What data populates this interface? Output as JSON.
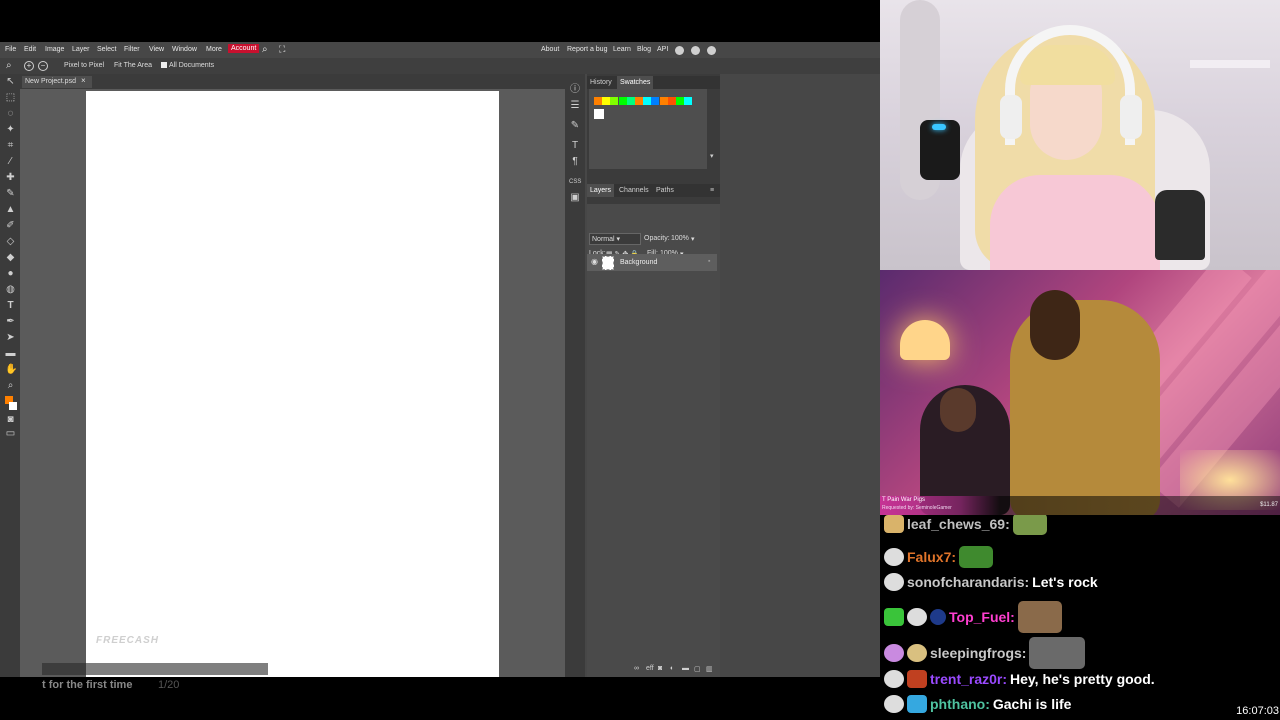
{
  "editor": {
    "menu": [
      "File",
      "Edit",
      "Image",
      "Layer",
      "Select",
      "Filter",
      "View",
      "Window",
      "More"
    ],
    "account_label": "Account",
    "right_links": [
      "About",
      "Report a bug",
      "Learn",
      "Blog",
      "API"
    ],
    "options": {
      "pixel_to_pixel": "Pixel to Pixel",
      "fit_area": "Fit The Area",
      "all_documents": "All Documents"
    },
    "document_tab": "New Project.psd",
    "watermark": "FREECASH",
    "panel_tabs_top": [
      "History",
      "Swatches"
    ],
    "active_top_tab": "Swatches",
    "swatches": [
      "#ff8000",
      "#ffff00",
      "#80ff00",
      "#00ff00",
      "#00ff80",
      "#ff8000",
      "#00ffff",
      "#0080ff",
      "#ff8000",
      "#ff5000",
      "#00ff00",
      "#00ffff",
      "#ffffff"
    ],
    "panel_tabs_layers": [
      "Layers",
      "Channels",
      "Paths"
    ],
    "blend_mode": "Normal",
    "opacity_label": "Opacity:",
    "opacity_value": "100%",
    "lock_label": "Lock:",
    "fill_label": "Fill:",
    "fill_value": "100%",
    "layer_name": "Background"
  },
  "bottom": {
    "caption": "t for the first time",
    "count": "1/20"
  },
  "video": {
    "song_title": "T Pain War Pigs",
    "requested_by": "Requested by: SeminoleGamer",
    "price": "$11.87"
  },
  "chat": {
    "messages": [
      {
        "user": "leaf_chews_69:",
        "color": "#c0c0c0",
        "text": ""
      },
      {
        "user": "Falux7:",
        "color": "#e0742a",
        "text": ""
      },
      {
        "user": "sonofcharandaris:",
        "color": "#c8c8c8",
        "text": "Let's rock"
      },
      {
        "user": "Top_Fuel:",
        "color": "#ff3fd0",
        "text": ""
      },
      {
        "user": "sleepingfrogs:",
        "color": "#c8c8c8",
        "text": ""
      },
      {
        "user": "trent_raz0r:",
        "color": "#9a4aff",
        "text": "Hey, he's pretty good."
      },
      {
        "user": "phthano:",
        "color": "#4fc3a0",
        "text": "Gachi is life"
      }
    ],
    "clock": "16:07:03"
  }
}
